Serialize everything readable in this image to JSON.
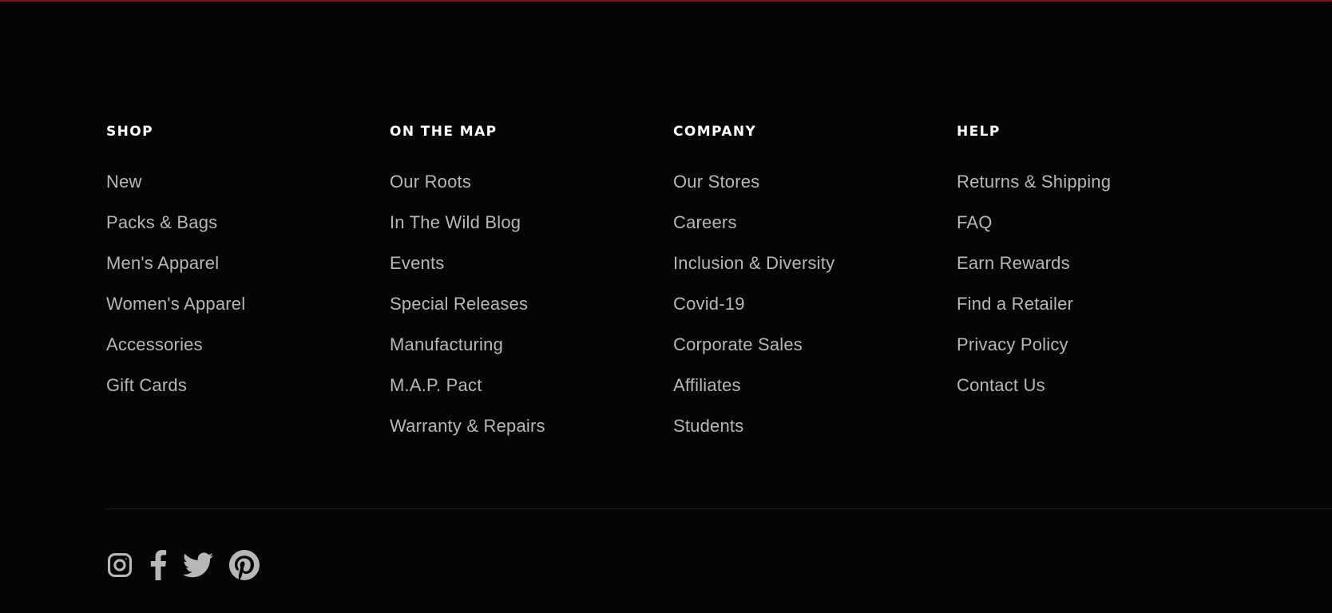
{
  "colors": {
    "background": "#050505",
    "top_rule": "#7d1419",
    "heading": "#ffffff",
    "link": "#b7b7b7",
    "icon": "#b7b7b7"
  },
  "footer": {
    "columns": [
      {
        "heading": "SHOP",
        "links": [
          "New",
          "Packs & Bags",
          "Men's Apparel",
          "Women's Apparel",
          "Accessories",
          "Gift Cards"
        ]
      },
      {
        "heading": "ON THE MAP",
        "links": [
          "Our Roots",
          "In The Wild Blog",
          "Events",
          "Special Releases",
          "Manufacturing",
          "M.A.P. Pact",
          "Warranty & Repairs"
        ]
      },
      {
        "heading": "COMPANY",
        "links": [
          "Our Stores",
          "Careers",
          "Inclusion & Diversity",
          "Covid-19",
          "Corporate Sales",
          "Affiliates",
          "Students"
        ]
      },
      {
        "heading": "HELP",
        "links": [
          "Returns & Shipping",
          "FAQ",
          "Earn Rewards",
          "Find a Retailer",
          "Privacy Policy",
          "Contact Us"
        ]
      }
    ],
    "social": [
      {
        "icon": "instagram-icon"
      },
      {
        "icon": "facebook-icon"
      },
      {
        "icon": "twitter-icon"
      },
      {
        "icon": "pinterest-icon"
      }
    ]
  }
}
